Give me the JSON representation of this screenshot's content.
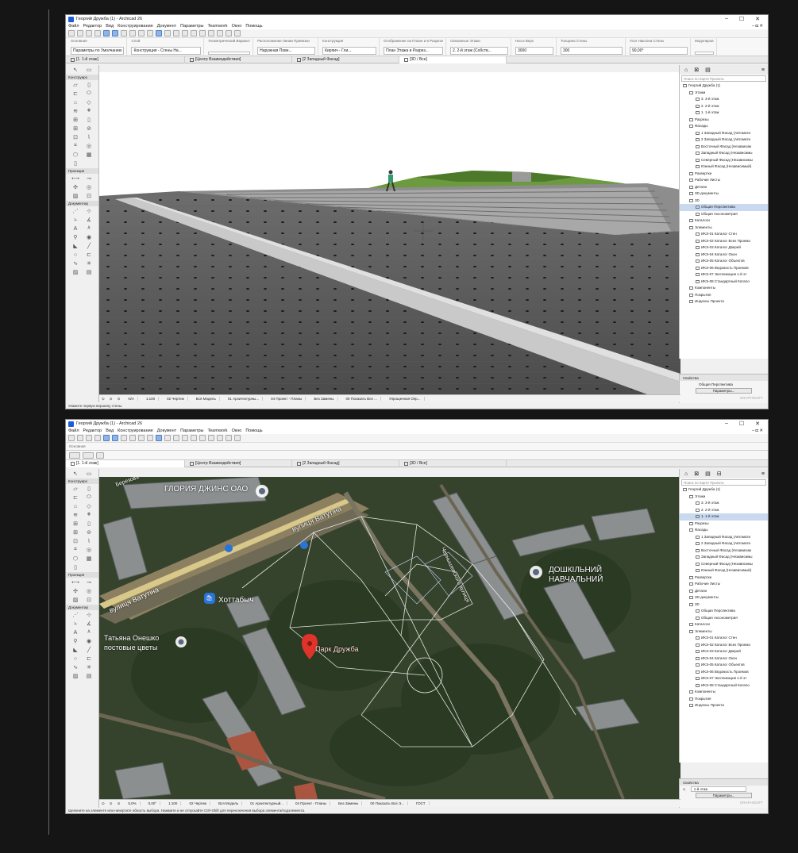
{
  "app": {
    "title": "Георгий Дружба (1) - Archicad 26",
    "menu": [
      "Файл",
      "Редактор",
      "Вид",
      "Конструирование",
      "Документ",
      "Параметры",
      "Teamwork",
      "Окно",
      "Помощь"
    ],
    "window_controls": [
      "–",
      "☐",
      "✕"
    ],
    "mdi_controls": "– ◘ ✕"
  },
  "infobox": {
    "groups": [
      {
        "caption": "Основная",
        "value": "Параметры по Умолчанию"
      },
      {
        "caption": "Слой",
        "value": "Конструкция - Стены На..."
      },
      {
        "caption": "Геометрический Вариант",
        "value": ""
      },
      {
        "caption": "Расположение Линии Привязки",
        "value": "Наружная Пове..."
      },
      {
        "caption": "Конструкция",
        "value": "Кирпич - Гли..."
      },
      {
        "caption": "Отображение на Плане и в Разрезе",
        "value": "План Этажа и Разрез..."
      },
      {
        "caption": "Связанные Этажи",
        "value": "2. 2-й этаж (Собств..."
      },
      {
        "caption": "Низ и Верх",
        "value": "3000"
      },
      {
        "caption": "Толщина Стены",
        "value": "300"
      },
      {
        "caption": "Угол Наклона Стены",
        "value": "90,00°"
      },
      {
        "caption": "Моделиров",
        "value": ""
      }
    ],
    "main_label": "Основная"
  },
  "tabs_top": [
    "[1. 1-й этаж]",
    "[Центр Взаимодействия]",
    "[2 Западный Фасад]",
    "[3D / Все]"
  ],
  "tabs_bottom": [
    "[1. 1-й этаж]",
    "[Центр Взаимодействия]",
    "[2 Западный Фасад]",
    "[3D / Все]"
  ],
  "toolbox": {
    "sections": [
      "Конструиро",
      "Проекция",
      "Документир"
    ]
  },
  "navigator": {
    "search_placeholder": "Поиск по Карте Проекта",
    "tree": [
      {
        "label": "Георгий Дружба (1)",
        "indent": 0
      },
      {
        "label": "Этажи",
        "indent": 1
      },
      {
        "label": "3. 3-й этаж",
        "indent": 2
      },
      {
        "label": "2. 2-й этаж",
        "indent": 2
      },
      {
        "label": "1. 1-й этаж",
        "indent": 2
      },
      {
        "label": "Разрезы",
        "indent": 1
      },
      {
        "label": "Фасады",
        "indent": 1
      },
      {
        "label": "1 Западный Фасад (Автомати",
        "indent": 2
      },
      {
        "label": "2 Западный Фасад (Автомати",
        "indent": 2
      },
      {
        "label": "Восточный Фасад (Независим",
        "indent": 2
      },
      {
        "label": "Западный Фасад (Независимы",
        "indent": 2
      },
      {
        "label": "Северный Фасад (Независимы",
        "indent": 2
      },
      {
        "label": "Южный Фасад (Независимый)",
        "indent": 2
      },
      {
        "label": "Развертки",
        "indent": 1
      },
      {
        "label": "Рабочие Листы",
        "indent": 1
      },
      {
        "label": "Детали",
        "indent": 1
      },
      {
        "label": "3D-документы",
        "indent": 1
      },
      {
        "label": "3D",
        "indent": 1
      },
      {
        "label": "Общая Перспектива",
        "indent": 2
      },
      {
        "label": "Общая Аксонометрия",
        "indent": 2
      },
      {
        "label": "Каталоги",
        "indent": 1
      },
      {
        "label": "Элементы",
        "indent": 1
      },
      {
        "label": "ИКЭ-01 Каталог Стен",
        "indent": 2
      },
      {
        "label": "ИКЭ-02 Каталог Всех Проемо",
        "indent": 2
      },
      {
        "label": "ИКЭ-03 Каталог Дверей",
        "indent": 2
      },
      {
        "label": "ИКЭ-04 Каталог Окон",
        "indent": 2
      },
      {
        "label": "ИКЭ-05 Каталог Объектов",
        "indent": 2
      },
      {
        "label": "ИКЭ-06 Ведомость Проемов",
        "indent": 2
      },
      {
        "label": "ИКЭ-07 Экспликация 1-й эт",
        "indent": 2
      },
      {
        "label": "ИКЭ-08 Стандартный Катало",
        "indent": 2
      },
      {
        "label": "Компоненты",
        "indent": 1
      },
      {
        "label": "Покрытия",
        "indent": 1
      },
      {
        "label": "Индексы Проекта",
        "indent": 1
      }
    ],
    "selected_top": "Общая Перспектива",
    "selected_bottom": "1. 1-й этаж"
  },
  "properties": {
    "header": "Свойства",
    "top_value": "Общая Перспектива",
    "bottom_label": "1.",
    "bottom_value": "1-й этаж",
    "button": "Параметры...",
    "brand": "GRAPHISOFT"
  },
  "status_top": [
    "N/A",
    "1:100",
    "02 Чертеж",
    "Вся Модель",
    "01 Архитектурны...",
    "04 Проект - Планы",
    "Без Замены",
    "00 Показать Все ...",
    "Упрощенная Опр..."
  ],
  "status_bottom": [
    "5,0%",
    "0,00°",
    "1:100",
    "02 Чертеж",
    "Вся Модель",
    "01 Архитектурный...",
    "04 Проект - Планы",
    "Без Замены",
    "00 Показать Все Э...",
    "ГОСТ"
  ],
  "hint_top": "Укажите первую вершину стены.",
  "hint_bottom": "Щелкните на элементе или начертите область выбора. Нажмите и не отпускайте Ctrl+Shift для переключения выбора элемента/подэлемента.",
  "map": {
    "labels": [
      {
        "text": "ГЛОРИЯ ДЖИНС ОАО"
      },
      {
        "text": "вулиця Ватутіна"
      },
      {
        "text": "вулиця Ватутіна"
      },
      {
        "text": "Хоттабыч"
      },
      {
        "text": "Татьяна Онешко"
      },
      {
        "text": "постовые цветы"
      },
      {
        "text": "Парк Дружба"
      },
      {
        "text": "ДОШКІЛЬНИЙ"
      },
      {
        "text": "НАВЧАЛЬНИЙ"
      },
      {
        "text": "Чернышевского вулиця"
      },
      {
        "text": "Березова"
      }
    ]
  }
}
